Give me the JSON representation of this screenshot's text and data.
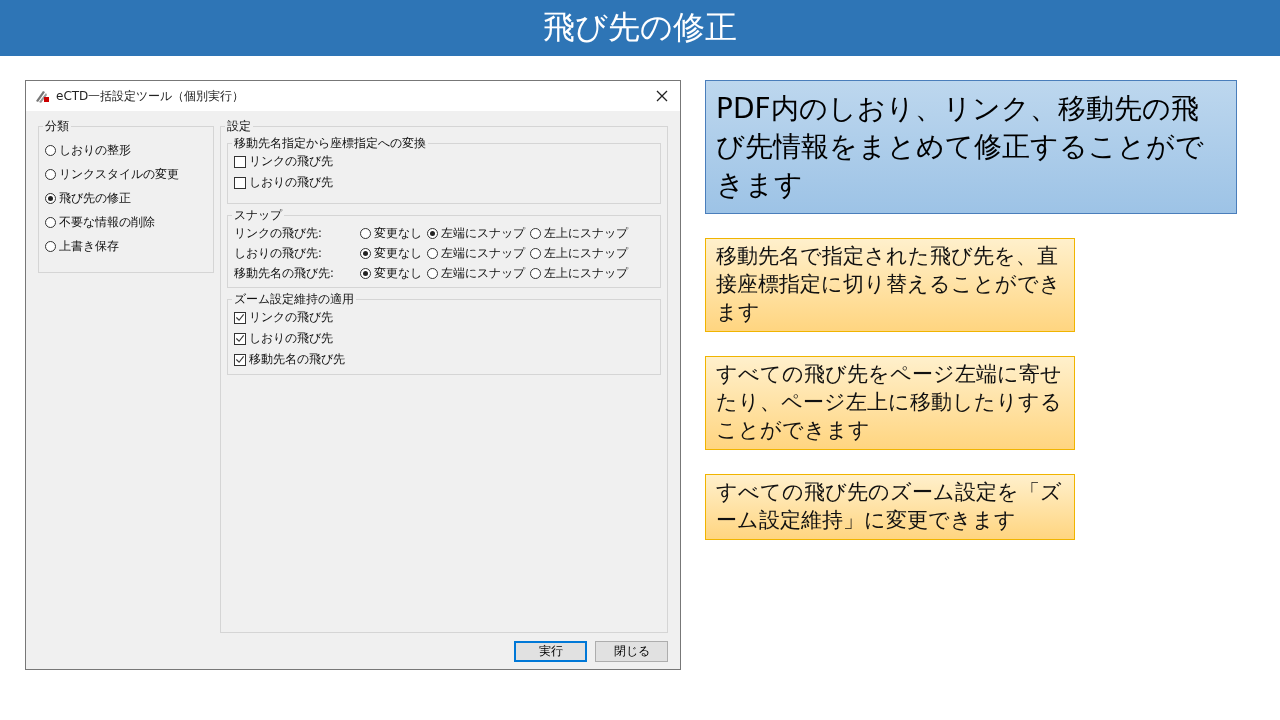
{
  "slide_title": "飛び先の修正",
  "dialog": {
    "title": "eCTD一括設定ツール（個別実行）",
    "category": {
      "legend": "分類",
      "options": [
        {
          "label": "しおりの整形",
          "selected": false
        },
        {
          "label": "リンクスタイルの変更",
          "selected": false
        },
        {
          "label": "飛び先の修正",
          "selected": true
        },
        {
          "label": "不要な情報の削除",
          "selected": false
        },
        {
          "label": "上書き保存",
          "selected": false
        }
      ]
    },
    "settings": {
      "legend": "設定",
      "conversion": {
        "legend": "移動先名指定から座標指定への変換",
        "checkboxes": [
          {
            "label": "リンクの飛び先",
            "checked": false
          },
          {
            "label": "しおりの飛び先",
            "checked": false
          }
        ]
      },
      "snap": {
        "legend": "スナップ",
        "rows": [
          {
            "label": "リンクの飛び先:",
            "options": [
              {
                "label": "変更なし",
                "selected": false
              },
              {
                "label": "左端にスナップ",
                "selected": true
              },
              {
                "label": "左上にスナップ",
                "selected": false
              }
            ]
          },
          {
            "label": "しおりの飛び先:",
            "options": [
              {
                "label": "変更なし",
                "selected": true
              },
              {
                "label": "左端にスナップ",
                "selected": false
              },
              {
                "label": "左上にスナップ",
                "selected": false
              }
            ]
          },
          {
            "label": "移動先名の飛び先:",
            "options": [
              {
                "label": "変更なし",
                "selected": true
              },
              {
                "label": "左端にスナップ",
                "selected": false
              },
              {
                "label": "左上にスナップ",
                "selected": false
              }
            ]
          }
        ]
      },
      "zoom": {
        "legend": "ズーム設定維持の適用",
        "checkboxes": [
          {
            "label": "リンクの飛び先",
            "checked": true
          },
          {
            "label": "しおりの飛び先",
            "checked": true
          },
          {
            "label": "移動先名の飛び先",
            "checked": true
          }
        ]
      }
    },
    "buttons": [
      {
        "label": "実行",
        "default": true
      },
      {
        "label": "閉じる",
        "default": false
      }
    ]
  },
  "callouts": [
    {
      "kind": "headline",
      "text": "PDF内のしおり、リンク、移動先の飛び先情報をまとめて修正することができます"
    },
    {
      "kind": "note",
      "text": "移動先名で指定された飛び先を、直接座標指定に切り替えることができます"
    },
    {
      "kind": "note",
      "text": "すべての飛び先をページ左端に寄せたり、ページ左上に移動したりすることができます"
    },
    {
      "kind": "note",
      "text": "すべての飛び先のズーム設定を「ズーム設定維持」に変更できます"
    }
  ]
}
